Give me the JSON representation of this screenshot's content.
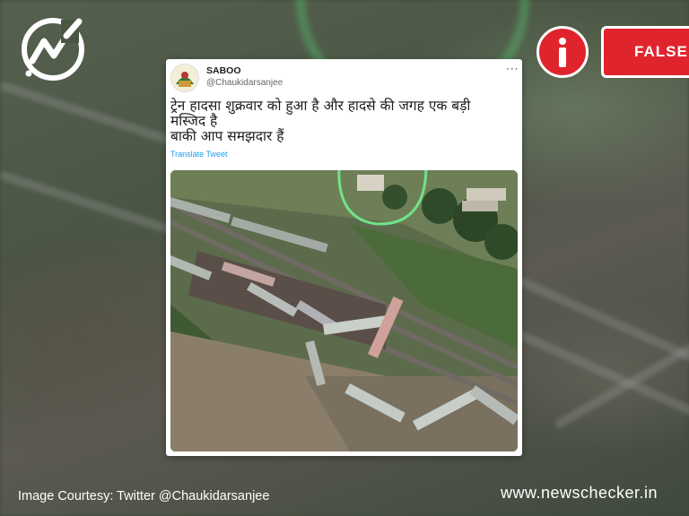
{
  "brand": {
    "logo_icon": "newschecker-logo-icon",
    "site": "www.newschecker.in"
  },
  "verdict": {
    "icon": "info-icon",
    "label": "FALSE",
    "color": "#e0242d"
  },
  "tweet": {
    "display_name": "SABOO",
    "handle": "@Chaukidarsanjee",
    "more_icon": "···",
    "text_line1": "ट्रेन हादसा शुक्रवार को हुआ है और हादसे की जगह एक बड़ी",
    "text_line2": "मस्जिद है",
    "text_line3": "बाकी आप समझदार हैं",
    "translate_label": "Translate Tweet",
    "photo": "aerial-train-accident-photo"
  },
  "footer": {
    "credit": "Image Courtesy: Twitter @Chaukidarsanjee"
  }
}
